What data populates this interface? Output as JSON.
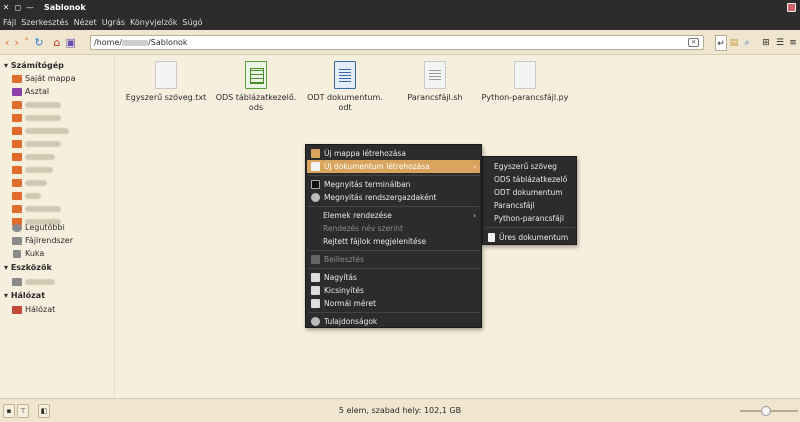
{
  "window": {
    "title": "Sablonok"
  },
  "menubar": [
    "Fájl",
    "Szerkesztés",
    "Nézet",
    "Ugrás",
    "Könyvjelzők",
    "Súgó"
  ],
  "address": {
    "prefix": "/home/",
    "suffix": "/Sablonok"
  },
  "sidebar": {
    "sections": [
      "Számítógép",
      "Eszközök",
      "Hálózat"
    ],
    "computer_items": [
      "Saját mappa",
      "Asztal"
    ],
    "computer_items2": [
      "Legutóbbi",
      "Fájlrendszer",
      "Kuka"
    ],
    "network_items": [
      "Hálózat"
    ]
  },
  "files": [
    {
      "name": "Egyszerű szöveg.txt",
      "type": "txt"
    },
    {
      "name": "ODS táblázatkezelő.\nods",
      "type": "ods"
    },
    {
      "name": "ODT dokumentum.\nodt",
      "type": "odt"
    },
    {
      "name": "Parancsfájl.sh",
      "type": "sh"
    },
    {
      "name": "Python-parancsfájl.py",
      "type": "py"
    }
  ],
  "context_menu": {
    "items": [
      "Új mappa létrehozása",
      "Új dokumentum létrehozása",
      "Megnyitás terminálban",
      "Megnyitás rendszergazdaként",
      "Elemek rendezése",
      "Rendezés név szerint",
      "Rejtett fájlok megjelenítése",
      "Beillesztés",
      "Nagyítás",
      "Kicsinyítés",
      "Normál méret",
      "Tulajdonságok"
    ]
  },
  "submenu": {
    "items": [
      "Egyszerű szöveg",
      "ODS táblázatkezelő",
      "ODT dokumentum",
      "Parancsfájl",
      "Python-parancsfájl",
      "Üres dokumentum"
    ]
  },
  "status": {
    "text": "5 elem, szabad hely: 102,1 GB",
    "zoom_level": 0.45
  },
  "colors": {
    "highlight": "#d9a45e",
    "menu_bg": "#2c2c2c",
    "window_bg": "#f7efdd"
  }
}
